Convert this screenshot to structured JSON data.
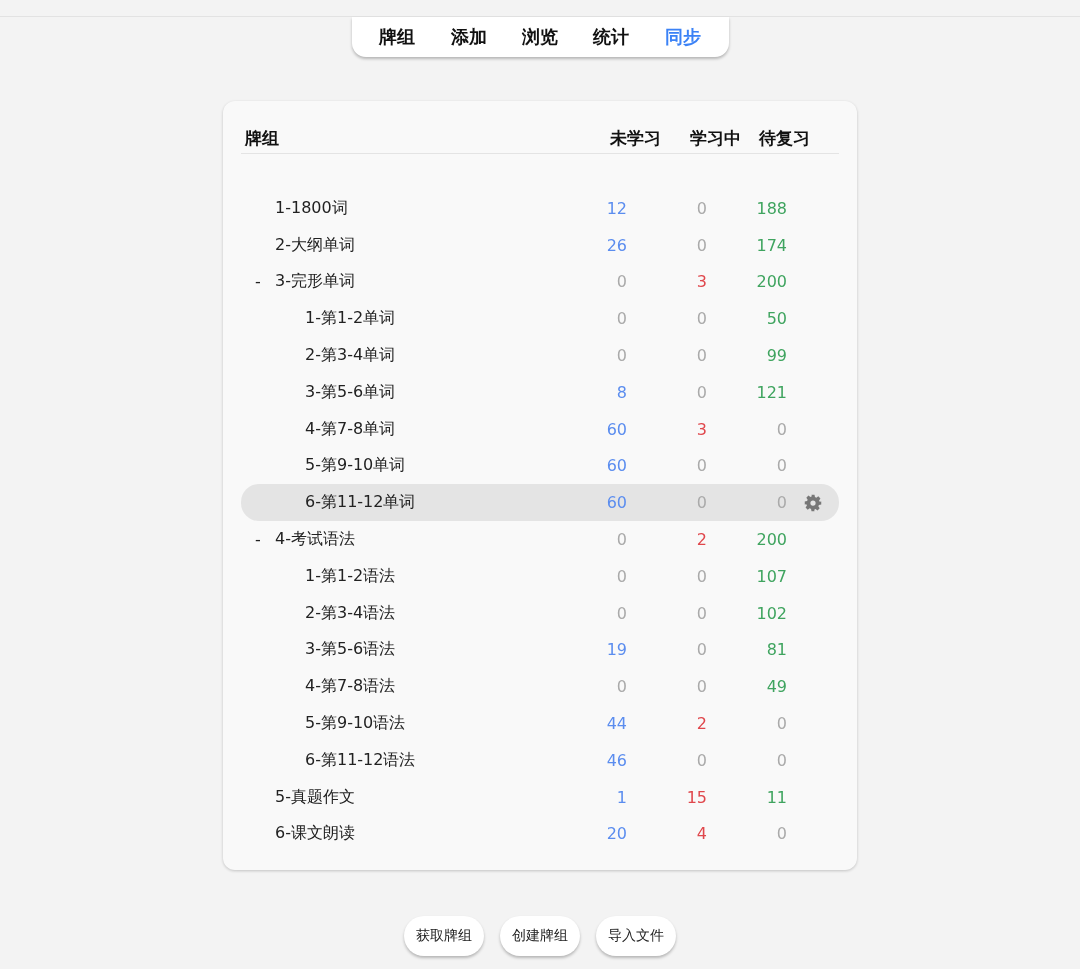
{
  "tabs": [
    {
      "label": "牌组",
      "selected": false
    },
    {
      "label": "添加",
      "selected": false
    },
    {
      "label": "浏览",
      "selected": false
    },
    {
      "label": "统计",
      "selected": false
    },
    {
      "label": "同步",
      "selected": true
    }
  ],
  "table": {
    "columns": [
      "牌组",
      "未学习",
      "学习中",
      "待复习"
    ],
    "decks": [
      {
        "name": "1-1800词",
        "selected": false,
        "counts": [
          {
            "value": "12",
            "color": "#5b8def"
          },
          {
            "value": "0",
            "color": "#aaaaaa"
          },
          {
            "value": "188",
            "color": "#3fa45f"
          }
        ]
      },
      {
        "name": "2-大纲单词",
        "selected": false,
        "counts": [
          {
            "value": "26",
            "color": "#5b8def"
          },
          {
            "value": "0",
            "color": "#aaaaaa"
          },
          {
            "value": "174",
            "color": "#3fa45f"
          }
        ]
      },
      {
        "name": "3-完形单词",
        "toggle": "-",
        "selected": false,
        "counts": [
          {
            "value": "0",
            "color": "#aaaaaa"
          },
          {
            "value": "3",
            "color": "#e0474c"
          },
          {
            "value": "200",
            "color": "#3fa45f"
          }
        ],
        "children": [
          {
            "name": "1-第1-2单词",
            "selected": false,
            "counts": [
              {
                "value": "0",
                "color": "#aaaaaa"
              },
              {
                "value": "0",
                "color": "#aaaaaa"
              },
              {
                "value": "50",
                "color": "#3fa45f"
              }
            ]
          },
          {
            "name": "2-第3-4单词",
            "selected": false,
            "counts": [
              {
                "value": "0",
                "color": "#aaaaaa"
              },
              {
                "value": "0",
                "color": "#aaaaaa"
              },
              {
                "value": "99",
                "color": "#3fa45f"
              }
            ]
          },
          {
            "name": "3-第5-6单词",
            "selected": false,
            "counts": [
              {
                "value": "8",
                "color": "#5b8def"
              },
              {
                "value": "0",
                "color": "#aaaaaa"
              },
              {
                "value": "121",
                "color": "#3fa45f"
              }
            ]
          },
          {
            "name": "4-第7-8单词",
            "selected": false,
            "counts": [
              {
                "value": "60",
                "color": "#5b8def"
              },
              {
                "value": "3",
                "color": "#e0474c"
              },
              {
                "value": "0",
                "color": "#aaaaaa"
              }
            ]
          },
          {
            "name": "5-第9-10单词",
            "selected": false,
            "counts": [
              {
                "value": "60",
                "color": "#5b8def"
              },
              {
                "value": "0",
                "color": "#aaaaaa"
              },
              {
                "value": "0",
                "color": "#aaaaaa"
              }
            ]
          },
          {
            "name": "6-第11-12单词",
            "selected": true,
            "counts": [
              {
                "value": "60",
                "color": "#5b8def"
              },
              {
                "value": "0",
                "color": "#aaaaaa"
              },
              {
                "value": "0",
                "color": "#aaaaaa"
              }
            ]
          }
        ]
      },
      {
        "name": "4-考试语法",
        "toggle": "-",
        "selected": false,
        "counts": [
          {
            "value": "0",
            "color": "#aaaaaa"
          },
          {
            "value": "2",
            "color": "#e0474c"
          },
          {
            "value": "200",
            "color": "#3fa45f"
          }
        ],
        "children": [
          {
            "name": "1-第1-2语法",
            "selected": false,
            "counts": [
              {
                "value": "0",
                "color": "#aaaaaa"
              },
              {
                "value": "0",
                "color": "#aaaaaa"
              },
              {
                "value": "107",
                "color": "#3fa45f"
              }
            ]
          },
          {
            "name": "2-第3-4语法",
            "selected": false,
            "counts": [
              {
                "value": "0",
                "color": "#aaaaaa"
              },
              {
                "value": "0",
                "color": "#aaaaaa"
              },
              {
                "value": "102",
                "color": "#3fa45f"
              }
            ]
          },
          {
            "name": "3-第5-6语法",
            "selected": false,
            "counts": [
              {
                "value": "19",
                "color": "#5b8def"
              },
              {
                "value": "0",
                "color": "#aaaaaa"
              },
              {
                "value": "81",
                "color": "#3fa45f"
              }
            ]
          },
          {
            "name": "4-第7-8语法",
            "selected": false,
            "counts": [
              {
                "value": "0",
                "color": "#aaaaaa"
              },
              {
                "value": "0",
                "color": "#aaaaaa"
              },
              {
                "value": "49",
                "color": "#3fa45f"
              }
            ]
          },
          {
            "name": "5-第9-10语法",
            "selected": false,
            "counts": [
              {
                "value": "44",
                "color": "#5b8def"
              },
              {
                "value": "2",
                "color": "#e0474c"
              },
              {
                "value": "0",
                "color": "#aaaaaa"
              }
            ]
          },
          {
            "name": "6-第11-12语法",
            "selected": false,
            "counts": [
              {
                "value": "46",
                "color": "#5b8def"
              },
              {
                "value": "0",
                "color": "#aaaaaa"
              },
              {
                "value": "0",
                "color": "#aaaaaa"
              }
            ]
          }
        ]
      },
      {
        "name": "5-真题作文",
        "selected": false,
        "counts": [
          {
            "value": "1",
            "color": "#5b8def"
          },
          {
            "value": "15",
            "color": "#e0474c"
          },
          {
            "value": "11",
            "color": "#3fa45f"
          }
        ]
      },
      {
        "name": "6-课文朗读",
        "selected": false,
        "counts": [
          {
            "value": "20",
            "color": "#5b8def"
          },
          {
            "value": "4",
            "color": "#e0474c"
          },
          {
            "value": "0",
            "color": "#aaaaaa"
          }
        ]
      }
    ]
  },
  "buttons": [
    "获取牌组",
    "创建牌组",
    "导入文件"
  ]
}
